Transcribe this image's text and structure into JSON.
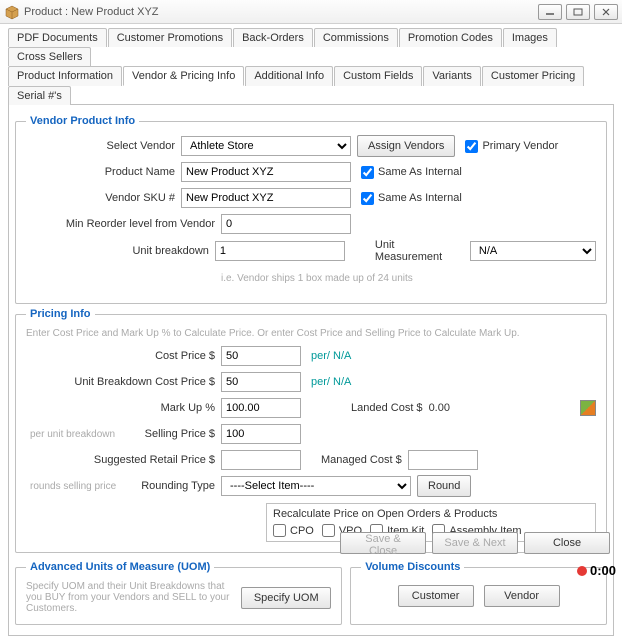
{
  "window": {
    "title": "Product : New Product XYZ"
  },
  "tabs_row1": [
    "PDF Documents",
    "Customer Promotions",
    "Back-Orders",
    "Commissions",
    "Promotion Codes",
    "Images",
    "Cross Sellers"
  ],
  "tabs_row2": [
    "Product Information",
    "Vendor & Pricing Info",
    "Additional Info",
    "Custom Fields",
    "Variants",
    "Customer Pricing",
    "Serial #'s"
  ],
  "active_tab": "Vendor & Pricing Info",
  "vendor": {
    "legend": "Vendor Product Info",
    "select_vendor_label": "Select Vendor",
    "select_vendor_value": "Athlete Store",
    "assign_vendors_btn": "Assign Vendors",
    "primary_vendor_label": "Primary Vendor",
    "primary_vendor_checked": true,
    "product_name_label": "Product Name",
    "product_name_value": "New Product XYZ",
    "same_as_internal_label": "Same As Internal",
    "same_as_internal1": true,
    "vendor_sku_label": "Vendor SKU #",
    "vendor_sku_value": "New Product XYZ",
    "same_as_internal2": true,
    "min_reorder_label": "Min Reorder level from Vendor",
    "min_reorder_value": "0",
    "unit_breakdown_label": "Unit breakdown",
    "unit_breakdown_value": "1",
    "unit_breakdown_hint": "i.e. Vendor ships 1 box made up of 24 units",
    "unit_measurement_label": "Unit Measurement",
    "unit_measurement_value": "N/A"
  },
  "pricing": {
    "legend": "Pricing Info",
    "hint": "Enter Cost Price and Mark Up % to Calculate Price. Or enter Cost Price and Selling Price to Calculate Mark Up.",
    "cost_price_label": "Cost Price $",
    "cost_price_value": "50",
    "per_na": "per/   N/A",
    "ubcp_label": "Unit Breakdown Cost Price $",
    "ubcp_value": "50",
    "markup_label": "Mark Up %",
    "markup_value": "100.00",
    "landed_cost_label": "Landed Cost $",
    "landed_cost_value": "0.00",
    "per_unit_hint": "per unit breakdown",
    "selling_price_label": "Selling Price $",
    "selling_price_value": "100",
    "srp_label": "Suggested Retail Price $",
    "managed_cost_label": "Managed Cost $",
    "rounding_hint": "rounds selling price",
    "rounding_type_label": "Rounding Type",
    "rounding_type_value": "----Select Item----",
    "round_btn": "Round",
    "recalc_title": "Recalculate Price on Open Orders & Products",
    "recalc_cpo": "CPO",
    "recalc_vpo": "VPO",
    "recalc_itemkit": "Item Kit",
    "recalc_assembly": "Assembly Item"
  },
  "uom": {
    "legend": "Advanced Units of Measure (UOM)",
    "hint": "Specify UOM and their Unit Breakdowns that you BUY from your Vendors and SELL to your Customers.",
    "btn": "Specify UOM"
  },
  "vol": {
    "legend": "Volume Discounts",
    "customer_btn": "Customer",
    "vendor_btn": "Vendor"
  },
  "buttons": {
    "save_close": "Save & Close",
    "save_next": "Save & Next",
    "close": "Close"
  },
  "timer": "0:00"
}
